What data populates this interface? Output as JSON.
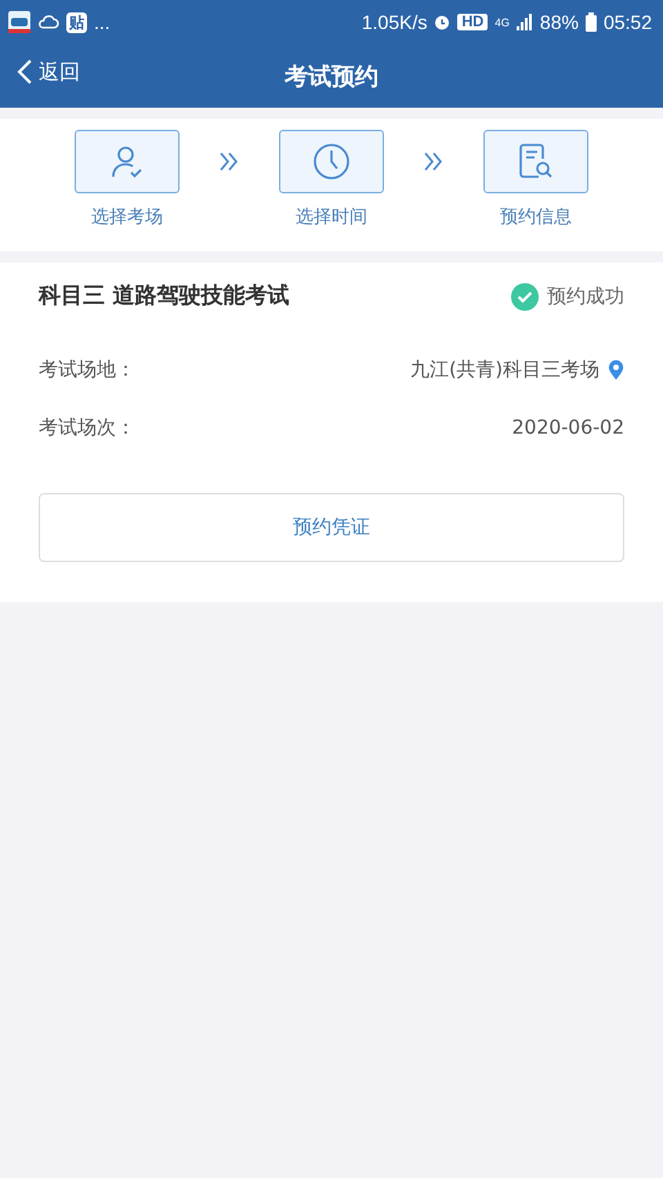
{
  "status_bar": {
    "left_badge": "贴",
    "left_more": "...",
    "speed": "1.05K/s",
    "hd": "HD",
    "network": "4G",
    "battery": "88%",
    "time": "05:52"
  },
  "header": {
    "back": "返回",
    "title": "考试预约"
  },
  "steps": [
    {
      "kind": "person",
      "label": "选择考场"
    },
    {
      "kind": "clock",
      "label": "选择时间"
    },
    {
      "kind": "document",
      "label": "预约信息"
    }
  ],
  "exam": {
    "title": "科目三 道路驾驶技能考试",
    "status": "预约成功",
    "success": true,
    "rows": [
      {
        "label": "考试场地：",
        "value": "九江(共青)科目三考场",
        "has_location": true
      },
      {
        "label": "考试场次：",
        "value": "2020-06-02",
        "has_location": false
      }
    ],
    "button": "预约凭证"
  }
}
